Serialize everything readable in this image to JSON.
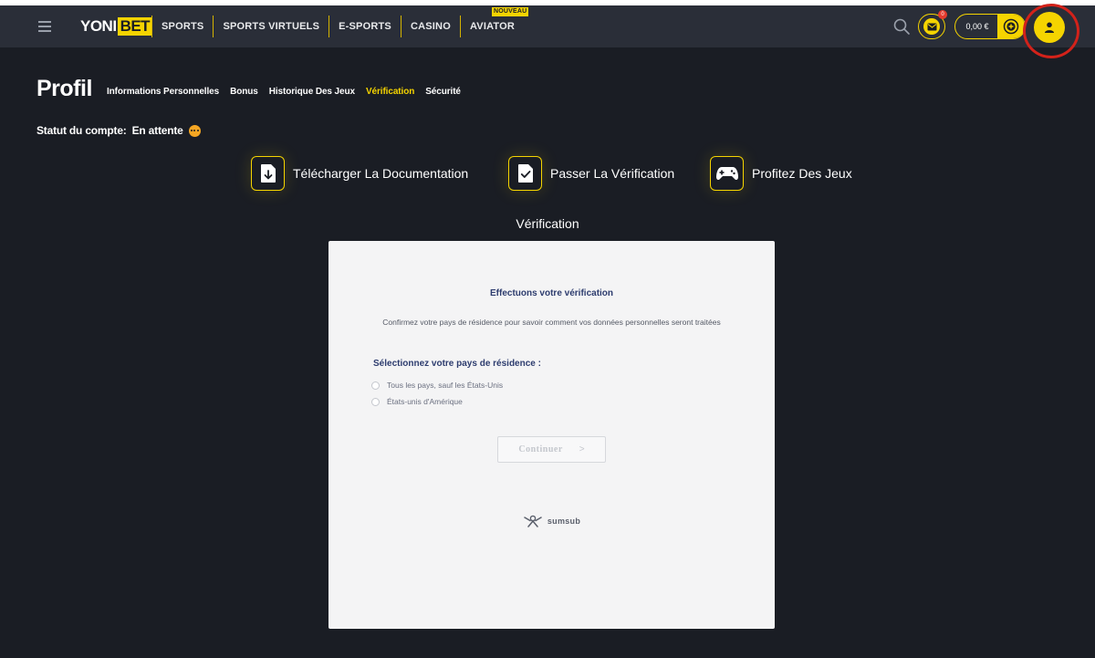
{
  "header": {
    "logo": {
      "part1": "YONI",
      "part2": "BET"
    },
    "nav": [
      {
        "label": "SPORTS"
      },
      {
        "label": "SPORTS VIRTUELS"
      },
      {
        "label": "E-SPORTS"
      },
      {
        "label": "CASINO"
      },
      {
        "label": "AVIATOR",
        "badge": "NOUVEAU"
      }
    ],
    "mail_count": "0",
    "balance": "0,00 €"
  },
  "profile": {
    "title": "Profil",
    "tabs": [
      {
        "label": "Informations Personnelles"
      },
      {
        "label": "Bonus"
      },
      {
        "label": "Historique Des Jeux"
      },
      {
        "label": "Vérification",
        "active": true
      },
      {
        "label": "Sécurité"
      }
    ],
    "status_label": "Statut du compte:",
    "status_value": "En attente"
  },
  "steps": [
    {
      "icon": "document-download-icon",
      "label": "Télécharger La Documentation"
    },
    {
      "icon": "document-check-icon",
      "label": "Passer La Vérification"
    },
    {
      "icon": "gamepad-icon",
      "label": "Profitez Des Jeux"
    }
  ],
  "verification": {
    "section_title": "Vérification",
    "heading": "Effectuons votre vérification",
    "description": "Confirmez votre pays de résidence pour savoir comment vos données personnelles seront traitées",
    "select_label": "Sélectionnez votre pays de résidence :",
    "options": [
      {
        "label": "Tous les pays, sauf les États-Unis",
        "selected": false
      },
      {
        "label": "États-unis d'Amérique",
        "selected": false
      }
    ],
    "continue_label": "Continuer",
    "continue_arrow": ">",
    "provider": "sumsub"
  },
  "colors": {
    "accent": "#f5d400",
    "background": "#1a1d24",
    "header": "#2a2e38",
    "panel": "#f4f4f5",
    "heading_text": "#2d3c6e",
    "highlight_ring": "#d3221a"
  }
}
